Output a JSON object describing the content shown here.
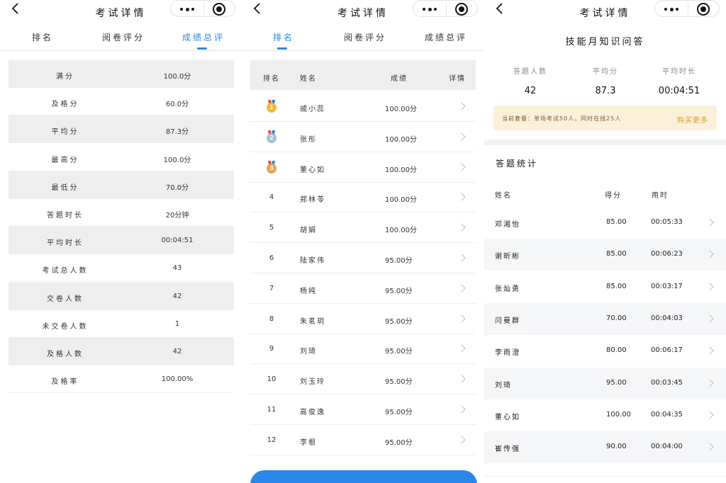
{
  "colors": {
    "accent": "#2a86e8",
    "gold": "#f5b935",
    "silver": "#a9bfd6",
    "bronze": "#e8a352",
    "banner_bg": "#fbf0d9",
    "buy_more": "#d99a2b"
  },
  "header": {
    "title": "考试详情",
    "back_icon": "chevron-left-icon",
    "more_icon": "more-dots-icon",
    "close_icon": "target-icon"
  },
  "tabs": [
    {
      "label": "排名"
    },
    {
      "label": "阅卷评分"
    },
    {
      "label": "成绩总评"
    }
  ],
  "summary": {
    "rows": [
      {
        "label": "满分",
        "value": "100.0分"
      },
      {
        "label": "及格分",
        "value": "60.0分"
      },
      {
        "label": "平均分",
        "value": "87.3分"
      },
      {
        "label": "最高分",
        "value": "100.0分"
      },
      {
        "label": "最低分",
        "value": "70.0分"
      },
      {
        "label": "答题时长",
        "value": "20分钟"
      },
      {
        "label": "平均时长",
        "value": "00:04:51"
      },
      {
        "label": "考试总人数",
        "value": "43"
      },
      {
        "label": "交卷人数",
        "value": "42"
      },
      {
        "label": "未交卷人数",
        "value": "1"
      },
      {
        "label": "及格人数",
        "value": "42"
      },
      {
        "label": "及格率",
        "value": "100.00%"
      }
    ]
  },
  "ranking": {
    "headers": {
      "rank": "排名",
      "name": "姓名",
      "score": "成绩",
      "detail": "详情"
    },
    "rows": [
      {
        "rank": "1",
        "name": "戚小蕊",
        "score": "100.00分",
        "medal": "gold"
      },
      {
        "rank": "2",
        "name": "张彤",
        "score": "100.00分",
        "medal": "silver"
      },
      {
        "rank": "3",
        "name": "董心如",
        "score": "100.00分",
        "medal": "bronze"
      },
      {
        "rank": "4",
        "name": "郑林苓",
        "score": "100.00分"
      },
      {
        "rank": "5",
        "name": "胡娟",
        "score": "100.00分"
      },
      {
        "rank": "6",
        "name": "陆家伟",
        "score": "95.00分"
      },
      {
        "rank": "7",
        "name": "杨纯",
        "score": "95.00分"
      },
      {
        "rank": "8",
        "name": "朱茗玥",
        "score": "95.00分"
      },
      {
        "rank": "9",
        "name": "刘琦",
        "score": "95.00分"
      },
      {
        "rank": "10",
        "name": "刘玉玲",
        "score": "95.00分"
      },
      {
        "rank": "11",
        "name": "高俊逸",
        "score": "95.00分"
      },
      {
        "rank": "12",
        "name": "李根",
        "score": "95.00分"
      }
    ]
  },
  "quiz": {
    "title": "技能月知识问答",
    "stats": [
      {
        "label": "答题人数",
        "value": "42"
      },
      {
        "label": "平均分",
        "value": "87.3"
      },
      {
        "label": "平均时长",
        "value": "00:04:51"
      }
    ],
    "banner": {
      "text": "当前套餐：单场考试50人，同时在线25人",
      "buy": "购买更多"
    },
    "section_title": "答题统计",
    "headers": {
      "name": "姓名",
      "score": "得分",
      "time": "用时"
    },
    "rows": [
      {
        "name": "邓湘怡",
        "score": "85.00",
        "time": "00:05:33"
      },
      {
        "name": "谢昕彬",
        "score": "85.00",
        "time": "00:06:23"
      },
      {
        "name": "张灿勇",
        "score": "85.00",
        "time": "00:03:17"
      },
      {
        "name": "闫曼群",
        "score": "70.00",
        "time": "00:04:03"
      },
      {
        "name": "李雨澄",
        "score": "80.00",
        "time": "00:06:17"
      },
      {
        "name": "刘琦",
        "score": "95.00",
        "time": "00:03:45"
      },
      {
        "name": "董心如",
        "score": "100.00",
        "time": "00:04:35"
      },
      {
        "name": "崔传强",
        "score": "90.00",
        "time": "00:04:00"
      }
    ]
  }
}
